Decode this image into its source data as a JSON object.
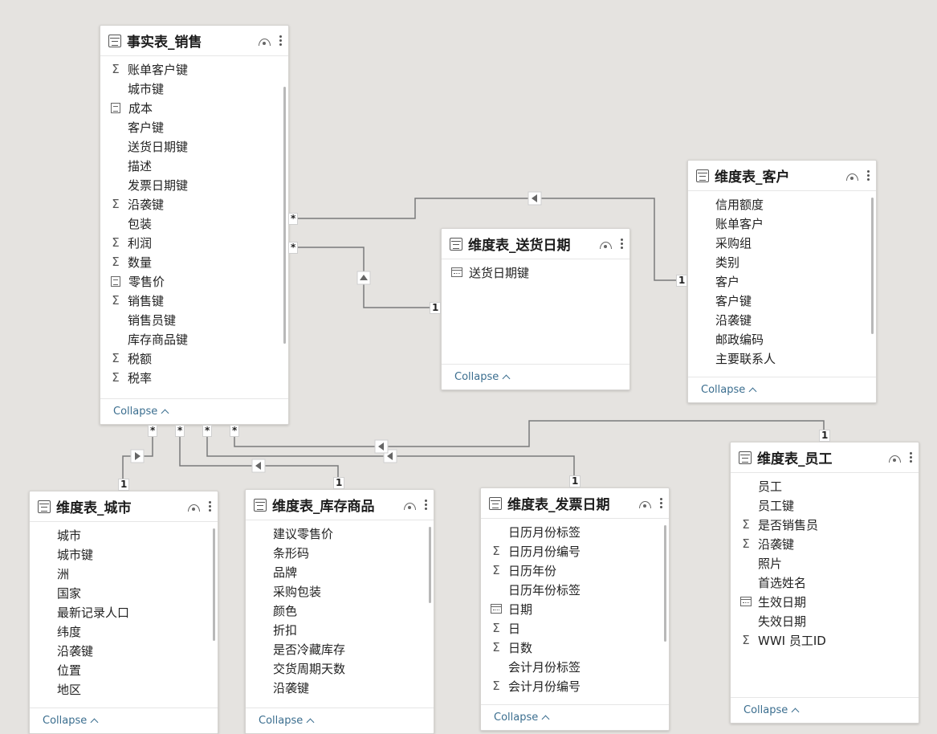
{
  "tables": [
    {
      "id": "fact",
      "title": "事实表_销售",
      "fields": [
        {
          "icon": "sum",
          "label": "账单客户键"
        },
        {
          "icon": "",
          "label": "城市键"
        },
        {
          "icon": "calc",
          "label": "成本"
        },
        {
          "icon": "",
          "label": "客户键"
        },
        {
          "icon": "",
          "label": "送货日期键"
        },
        {
          "icon": "",
          "label": "描述"
        },
        {
          "icon": "",
          "label": "发票日期键"
        },
        {
          "icon": "sum",
          "label": "沿袭键"
        },
        {
          "icon": "",
          "label": "包装"
        },
        {
          "icon": "sum",
          "label": "利润"
        },
        {
          "icon": "sum",
          "label": "数量"
        },
        {
          "icon": "calc",
          "label": "零售价"
        },
        {
          "icon": "sum",
          "label": "销售键"
        },
        {
          "icon": "",
          "label": "销售员键"
        },
        {
          "icon": "",
          "label": "库存商品键"
        },
        {
          "icon": "sum",
          "label": "税额"
        },
        {
          "icon": "sum",
          "label": "税率"
        }
      ],
      "footer": "Collapse"
    },
    {
      "id": "customer",
      "title": "维度表_客户",
      "fields": [
        {
          "icon": "",
          "label": "信用额度"
        },
        {
          "icon": "",
          "label": "账单客户"
        },
        {
          "icon": "",
          "label": "采购组"
        },
        {
          "icon": "",
          "label": "类别"
        },
        {
          "icon": "",
          "label": "客户"
        },
        {
          "icon": "",
          "label": "客户键"
        },
        {
          "icon": "",
          "label": "沿袭键"
        },
        {
          "icon": "",
          "label": "邮政编码"
        },
        {
          "icon": "",
          "label": "主要联系人"
        }
      ],
      "footer": "Collapse"
    },
    {
      "id": "delivery",
      "title": "维度表_送货日期",
      "fields": [
        {
          "icon": "cal",
          "label": "送货日期键"
        }
      ],
      "footer": "Collapse"
    },
    {
      "id": "city",
      "title": "维度表_城市",
      "fields": [
        {
          "icon": "",
          "label": "城市"
        },
        {
          "icon": "",
          "label": "城市键"
        },
        {
          "icon": "",
          "label": "洲"
        },
        {
          "icon": "",
          "label": "国家"
        },
        {
          "icon": "",
          "label": "最新记录人口"
        },
        {
          "icon": "",
          "label": "纬度"
        },
        {
          "icon": "",
          "label": "沿袭键"
        },
        {
          "icon": "",
          "label": "位置"
        },
        {
          "icon": "",
          "label": "地区"
        }
      ],
      "footer": "Collapse"
    },
    {
      "id": "stock",
      "title": "维度表_库存商品",
      "fields": [
        {
          "icon": "",
          "label": "建议零售价"
        },
        {
          "icon": "",
          "label": "条形码"
        },
        {
          "icon": "",
          "label": "品牌"
        },
        {
          "icon": "",
          "label": "采购包装"
        },
        {
          "icon": "",
          "label": "颜色"
        },
        {
          "icon": "",
          "label": "折扣"
        },
        {
          "icon": "",
          "label": "是否冷藏库存"
        },
        {
          "icon": "",
          "label": "交货周期天数"
        },
        {
          "icon": "",
          "label": "沿袭键"
        }
      ],
      "footer": "Collapse"
    },
    {
      "id": "invoice",
      "title": "维度表_发票日期",
      "fields": [
        {
          "icon": "",
          "label": "日历月份标签"
        },
        {
          "icon": "sum",
          "label": "日历月份编号"
        },
        {
          "icon": "sum",
          "label": "日历年份"
        },
        {
          "icon": "",
          "label": "日历年份标签"
        },
        {
          "icon": "cal",
          "label": "日期"
        },
        {
          "icon": "sum",
          "label": "日"
        },
        {
          "icon": "sum",
          "label": "日数"
        },
        {
          "icon": "",
          "label": "会计月份标签"
        },
        {
          "icon": "sum",
          "label": "会计月份编号"
        }
      ],
      "footer": "Collapse"
    },
    {
      "id": "employee",
      "title": "维度表_员工",
      "fields": [
        {
          "icon": "",
          "label": "员工"
        },
        {
          "icon": "",
          "label": "员工键"
        },
        {
          "icon": "sum",
          "label": "是否销售员"
        },
        {
          "icon": "sum",
          "label": "沿袭键"
        },
        {
          "icon": "",
          "label": "照片"
        },
        {
          "icon": "",
          "label": "首选姓名"
        },
        {
          "icon": "cal",
          "label": "生效日期"
        },
        {
          "icon": "",
          "label": "失效日期"
        },
        {
          "icon": "sum",
          "label": "WWI 员工ID"
        }
      ],
      "footer": "Collapse"
    }
  ],
  "relationships": [
    {
      "many": "*",
      "one": "1",
      "to": "customer"
    },
    {
      "many": "*",
      "one": "1",
      "to": "delivery"
    },
    {
      "many": "*",
      "one": "1",
      "to": "city"
    },
    {
      "many": "*",
      "one": "1",
      "to": "stock"
    },
    {
      "many": "*",
      "one": "1",
      "to": "invoice"
    },
    {
      "many": "*",
      "one": "1",
      "to": "employee"
    }
  ],
  "colors": {
    "canvas": "#e5e3e0",
    "line": "#7a7a7a",
    "link": "#3b6e8f"
  }
}
